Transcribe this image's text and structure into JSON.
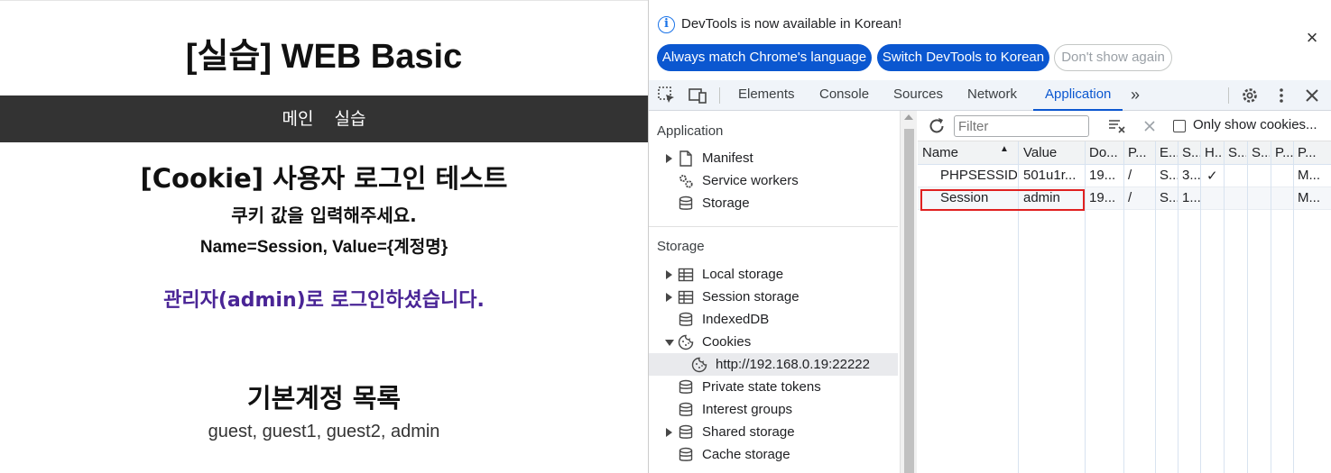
{
  "web": {
    "site_title": "[실습] WEB Basic",
    "nav": [
      "메인",
      "실습"
    ],
    "main_heading": "[Cookie] 사용자 로그인 테스트",
    "cookie_prompt": "쿠키 값을 입력해주세요.",
    "cookie_format": "Name=Session, Value={계정명}",
    "login_message": "관리자(admin)로 로그인하셨습니다.",
    "login_message_color": "#4a2596",
    "accounts_heading": "기본계정 목록",
    "accounts_list": "guest, guest1, guest2, admin",
    "nav_bg": "#333333"
  },
  "devtools": {
    "infobar": {
      "icon": "info-icon",
      "text": "DevTools is now available in Korean!",
      "btn_match": "Always match Chrome's language",
      "btn_switch": "Switch DevTools to Korean",
      "btn_dont": "Don't show again",
      "close": "×"
    },
    "tabs": [
      "Elements",
      "Console",
      "Sources",
      "Network",
      "Application"
    ],
    "active_tab": "Application",
    "more_tabs": "»",
    "accent": "#0b57d0",
    "sidebar": {
      "section_application": "Application",
      "application_items": [
        "Manifest",
        "Service workers",
        "Storage"
      ],
      "section_storage": "Storage",
      "storage_items": [
        "Local storage",
        "Session storage",
        "IndexedDB",
        "Cookies"
      ],
      "cookie_origin": "http://192.168.0.19:22222",
      "other_items": [
        "Private state tokens",
        "Interest groups",
        "Shared storage",
        "Cache storage"
      ]
    },
    "cookies": {
      "filter_placeholder": "Filter",
      "only_show_label": "Only show cookies...",
      "columns": [
        "Name",
        "Value",
        "Do...",
        "P...",
        "E...",
        "S...",
        "H...",
        "S...",
        "S...",
        "P...",
        "P..."
      ],
      "rows": [
        [
          "PHPSESSID",
          "501u1r...",
          "19...",
          "/",
          "S...",
          "3...",
          "✓",
          "",
          "",
          "",
          "M..."
        ],
        [
          "Session",
          "admin",
          "19...",
          "/",
          "S...",
          "1...",
          "",
          "",
          "",
          "",
          "M..."
        ]
      ],
      "highlight_color": "#e02020"
    }
  }
}
